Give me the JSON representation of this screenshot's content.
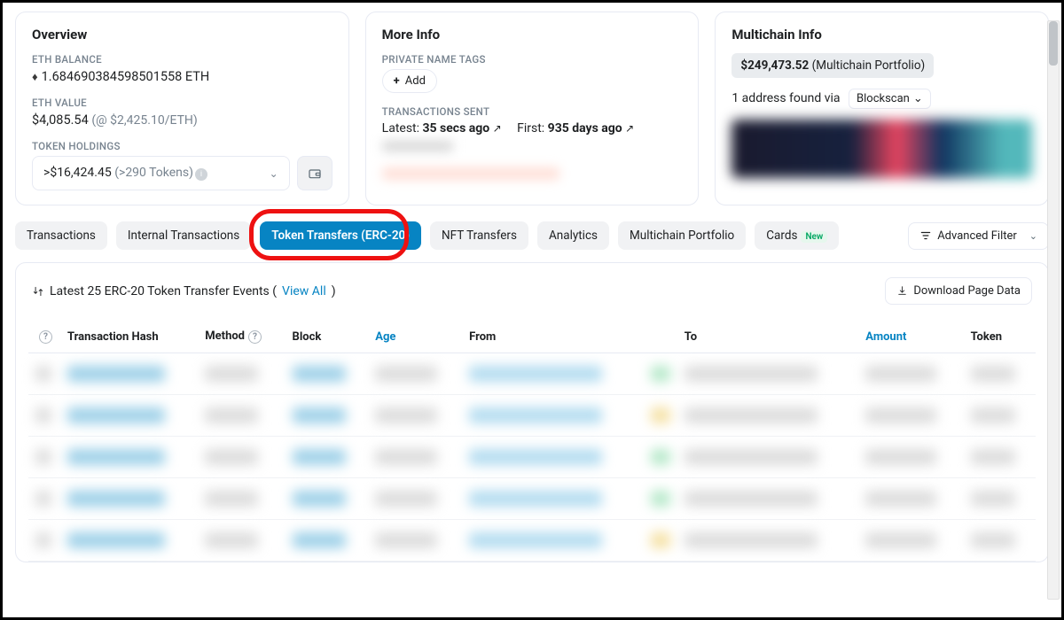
{
  "overview": {
    "title": "Overview",
    "eth_balance_label": "ETH BALANCE",
    "eth_balance": "1.684690384598501558 ETH",
    "eth_value_label": "ETH VALUE",
    "eth_value": "$4,085.54",
    "eth_rate": "(@ $2,425.10/ETH)",
    "holdings_label": "TOKEN HOLDINGS",
    "holdings_value": ">$16,424.45",
    "holdings_count": "(>290 Tokens)"
  },
  "moreinfo": {
    "title": "More Info",
    "tags_label": "PRIVATE NAME TAGS",
    "add_label": "Add",
    "tx_sent_label": "TRANSACTIONS SENT",
    "latest_label": "Latest:",
    "latest_val": "35 secs ago",
    "first_label": "First:",
    "first_val": "935 days ago"
  },
  "multichain": {
    "title": "Multichain Info",
    "badge_amount": "$249,473.52",
    "badge_note": "(Multichain Portfolio)",
    "found_text": "1 address found via",
    "blockscan": "Blockscan"
  },
  "tabs": {
    "transactions": "Transactions",
    "internal": "Internal Transactions",
    "token_transfers": "Token Transfers (ERC-20)",
    "nft": "NFT Transfers",
    "analytics": "Analytics",
    "multichain": "Multichain Portfolio",
    "cards": "Cards",
    "new": "New",
    "adv_filter": "Advanced Filter"
  },
  "section": {
    "summary_prefix": "Latest 25 ERC-20 Token Transfer Events (",
    "view_all": "View All",
    "summary_suffix": ")",
    "download": "Download Page Data"
  },
  "cols": {
    "hash": "Transaction Hash",
    "method": "Method",
    "block": "Block",
    "age": "Age",
    "from": "From",
    "to": "To",
    "amount": "Amount",
    "token": "Token"
  }
}
